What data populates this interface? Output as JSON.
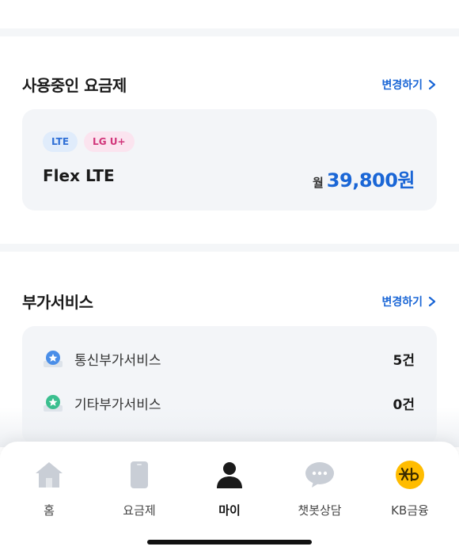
{
  "plan_section": {
    "title": "사용중인 요금제",
    "change_label": "변경하기",
    "badges": [
      "LTE",
      "LG U+"
    ],
    "plan_name": "Flex LTE",
    "price_prefix": "월",
    "price": "39,800원"
  },
  "addon_section": {
    "title": "부가서비스",
    "change_label": "변경하기",
    "items": [
      {
        "label": "통신부가서비스",
        "count": "5건",
        "icon": "telecom-addon-icon",
        "color": "#4a8ee8"
      },
      {
        "label": "기타부가서비스",
        "count": "0건",
        "icon": "other-addon-icon",
        "color": "#3bbf8f"
      }
    ]
  },
  "tabbar": {
    "tabs": [
      {
        "label": "홈",
        "icon": "home-icon"
      },
      {
        "label": "요금제",
        "icon": "phone-icon"
      },
      {
        "label": "마이",
        "icon": "person-icon",
        "active": true
      },
      {
        "label": "챗봇상담",
        "icon": "chat-bubble-icon"
      },
      {
        "label": "KB금융",
        "icon": "kb-logo-icon"
      }
    ]
  },
  "colors": {
    "accent": "#1a66d6",
    "card_bg": "#f3f5f8",
    "kb_yellow": "#ffbc00"
  }
}
